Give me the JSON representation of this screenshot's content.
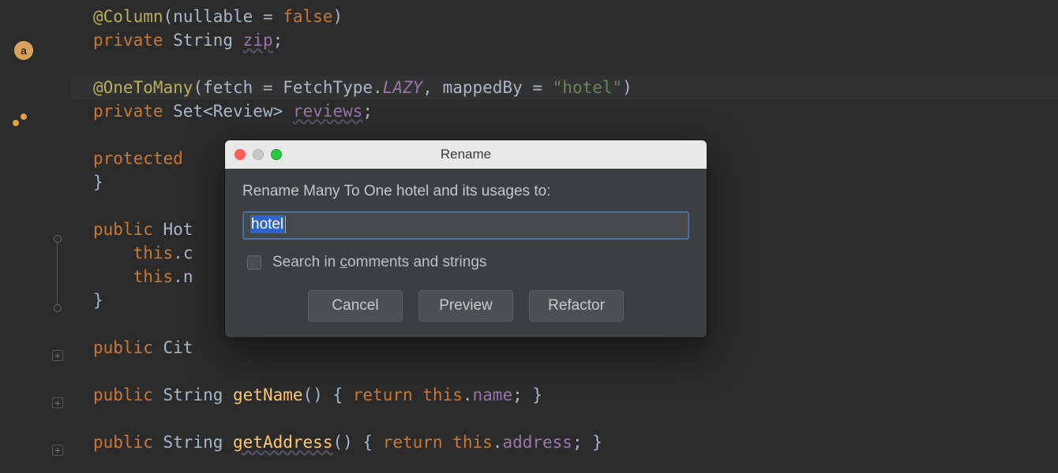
{
  "gutter": {
    "badge_letter": "a"
  },
  "code": {
    "l1": {
      "anno": "@Column",
      "args_open": "(",
      "kw1": "nullable ",
      "eq": "= ",
      "kw2": "false",
      "args_close": ")"
    },
    "l2": {
      "kw": "private ",
      "type": "String ",
      "field": "zip",
      "semi": ";"
    },
    "l3": {
      "anno": "@OneToMany",
      "args_open": "(",
      "p1": "fetch ",
      "eq1": "= ",
      "p1v": "FetchType.",
      "p1v2": "LAZY",
      "comma": ", ",
      "p2": "mappedBy ",
      "eq2": "= ",
      "str": "\"hotel\"",
      "args_close": ")"
    },
    "l4": {
      "kw": "private ",
      "type": "Set<Review> ",
      "field": "reviews",
      "semi": ";"
    },
    "l5": {
      "kw": "protected "
    },
    "l6": {
      "brace": "}"
    },
    "l7": {
      "kw": "public ",
      "type": "Hot"
    },
    "l8": {
      "this": "this",
      "dot": ".",
      "rest": "c"
    },
    "l9": {
      "this": "this",
      "dot": ".",
      "rest": "n"
    },
    "l10": {
      "brace": "}"
    },
    "l11": {
      "kw": "public ",
      "type": "Cit"
    },
    "l12": {
      "kw": "public ",
      "type": "String ",
      "method": "getName",
      "open": "() { ",
      "ret": "return ",
      "this": "this",
      "dot": ".",
      "field": "name",
      "close": "; }"
    },
    "l13": {
      "kw": "public ",
      "type": "String ",
      "method": "getAddress",
      "open": "() { ",
      "ret": "return ",
      "this": "this",
      "dot": ".",
      "field": "address",
      "close": "; }"
    }
  },
  "dialog": {
    "title": "Rename",
    "prompt": "Rename Many To One hotel and its usages to:",
    "input_value": "hotel",
    "checkbox_label_pre": "Search in ",
    "checkbox_mnemonic": "c",
    "checkbox_label_post": "omments and strings",
    "btn_cancel": "Cancel",
    "btn_preview": "Preview",
    "btn_refactor": "Refactor"
  }
}
